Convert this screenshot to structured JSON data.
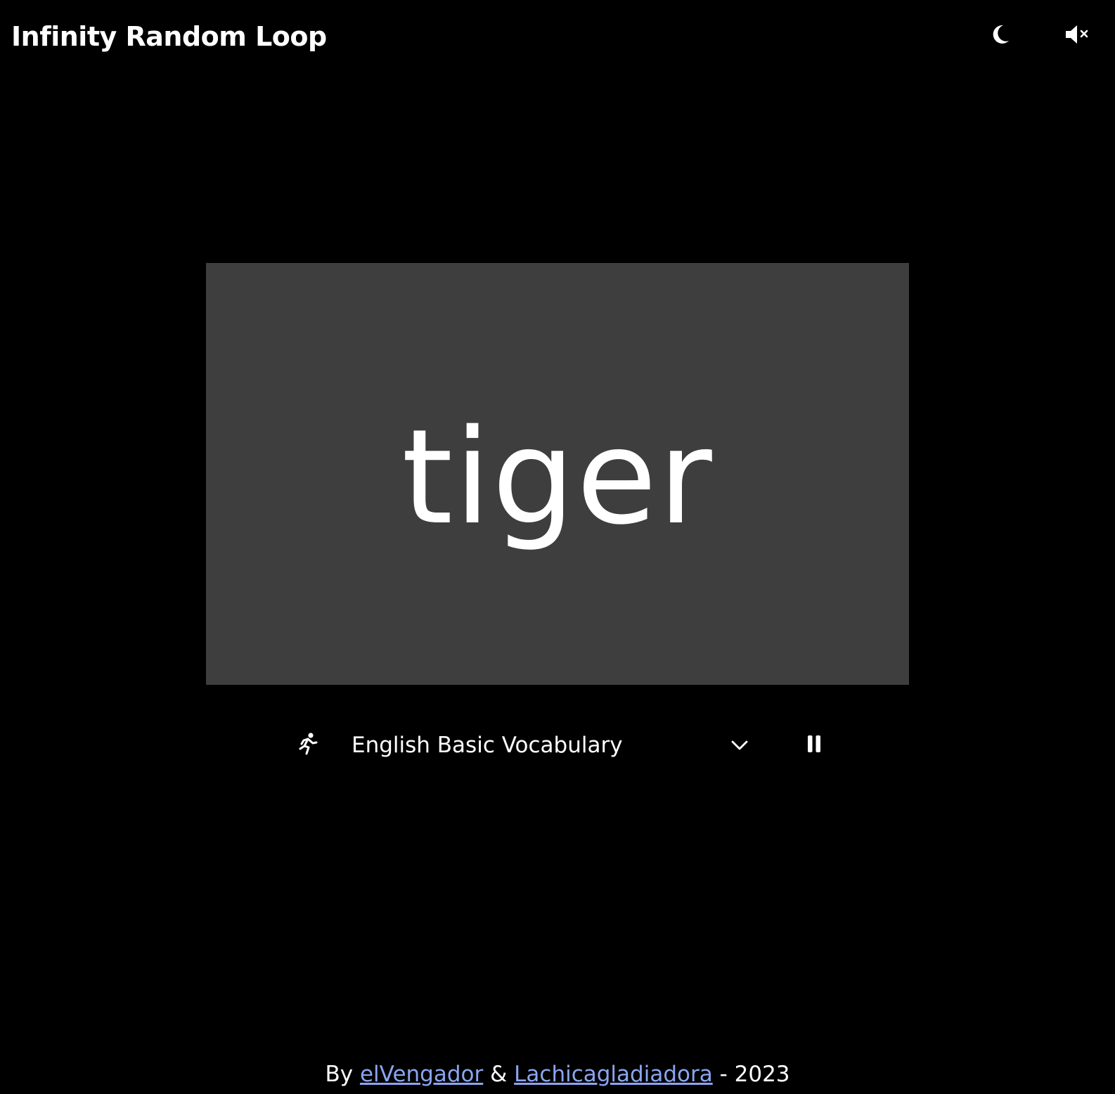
{
  "header": {
    "title": "Infinity Random Loop",
    "theme_icon": "moon-icon",
    "sound_icon": "speaker-muted-icon"
  },
  "card": {
    "word": "tiger",
    "background": "#3e3e3e"
  },
  "controls": {
    "speed_icon": "running-person-icon",
    "list_selected": "English Basic Vocabulary",
    "dropdown_icon": "chevron-down-icon",
    "playback_icon": "pause-icon"
  },
  "footer": {
    "by": "By",
    "author1": "elVengador",
    "amp": "&",
    "author2": "Lachicagladiadora",
    "year": "- 2023",
    "link_color": "#8aa6f0"
  }
}
